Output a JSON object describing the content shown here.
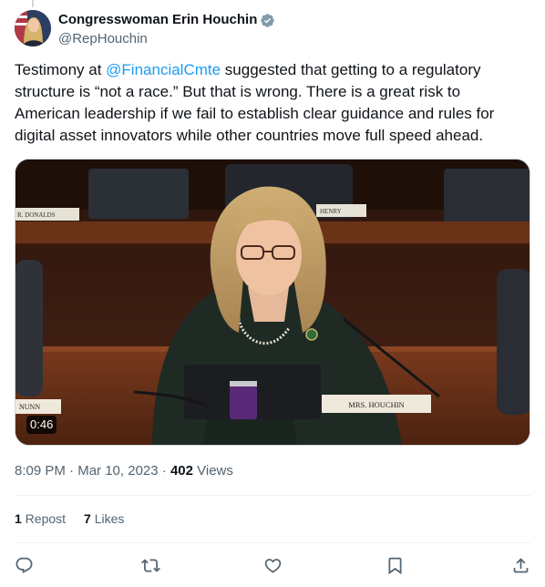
{
  "author": {
    "display_name": "Congresswoman Erin Houchin",
    "handle": "@RepHouchin"
  },
  "tweet": {
    "text_part1": "Testimony at ",
    "mention": "@FinancialCmte",
    "text_part2": " suggested that getting to a regulatory structure is “not a race.” But that is wrong. There is a great risk to American leadership if we fail to establish clear guidance and rules for digital asset innovators while other countries move full speed ahead."
  },
  "video": {
    "duration": "0:46",
    "nameplate_left_top": "R. DONALDS",
    "nameplate_right_top": "HENRY",
    "nameplate_left_bottom": "NUNN",
    "nameplate_main": "MRS. HOUCHIN"
  },
  "meta": {
    "time": "8:09 PM",
    "separator1": " · ",
    "date": "Mar 10, 2023",
    "separator2": " · ",
    "views_count": "402",
    "views_label": " Views"
  },
  "stats": {
    "reposts_count": "1",
    "reposts_label": " Repost",
    "likes_count": "7",
    "likes_label": " Likes"
  },
  "colors": {
    "accent": "#1d9bf0",
    "secondary_text": "#536471",
    "verified_badge": "#829aab"
  },
  "icons": [
    "reply-icon",
    "repost-icon",
    "like-icon",
    "bookmark-icon",
    "share-icon",
    "verified-icon"
  ]
}
